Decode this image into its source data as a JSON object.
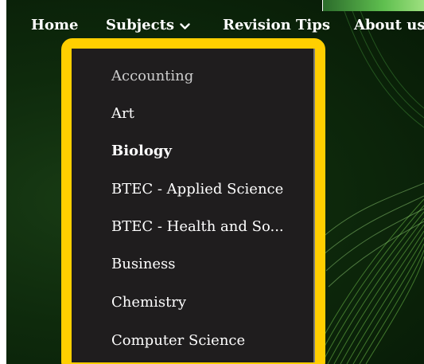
{
  "nav": {
    "home": "Home",
    "subjects": "Subjects",
    "revision_tips": "Revision Tips",
    "about": "About us"
  },
  "subjects_menu": {
    "items": [
      {
        "label": "Accounting"
      },
      {
        "label": "Art"
      },
      {
        "label": "Biology"
      },
      {
        "label": "BTEC - Applied Science"
      },
      {
        "label": "BTEC - Health and So..."
      },
      {
        "label": "Business"
      },
      {
        "label": "Chemistry"
      },
      {
        "label": "Computer Science"
      }
    ]
  },
  "colors": {
    "highlight_border": "#ffcf00",
    "menu_background": "#1f1d1e",
    "page_background": "#0e2a0c",
    "text": "#ffffff"
  },
  "icons": {
    "subjects_dropdown": "chevron-down-icon"
  }
}
